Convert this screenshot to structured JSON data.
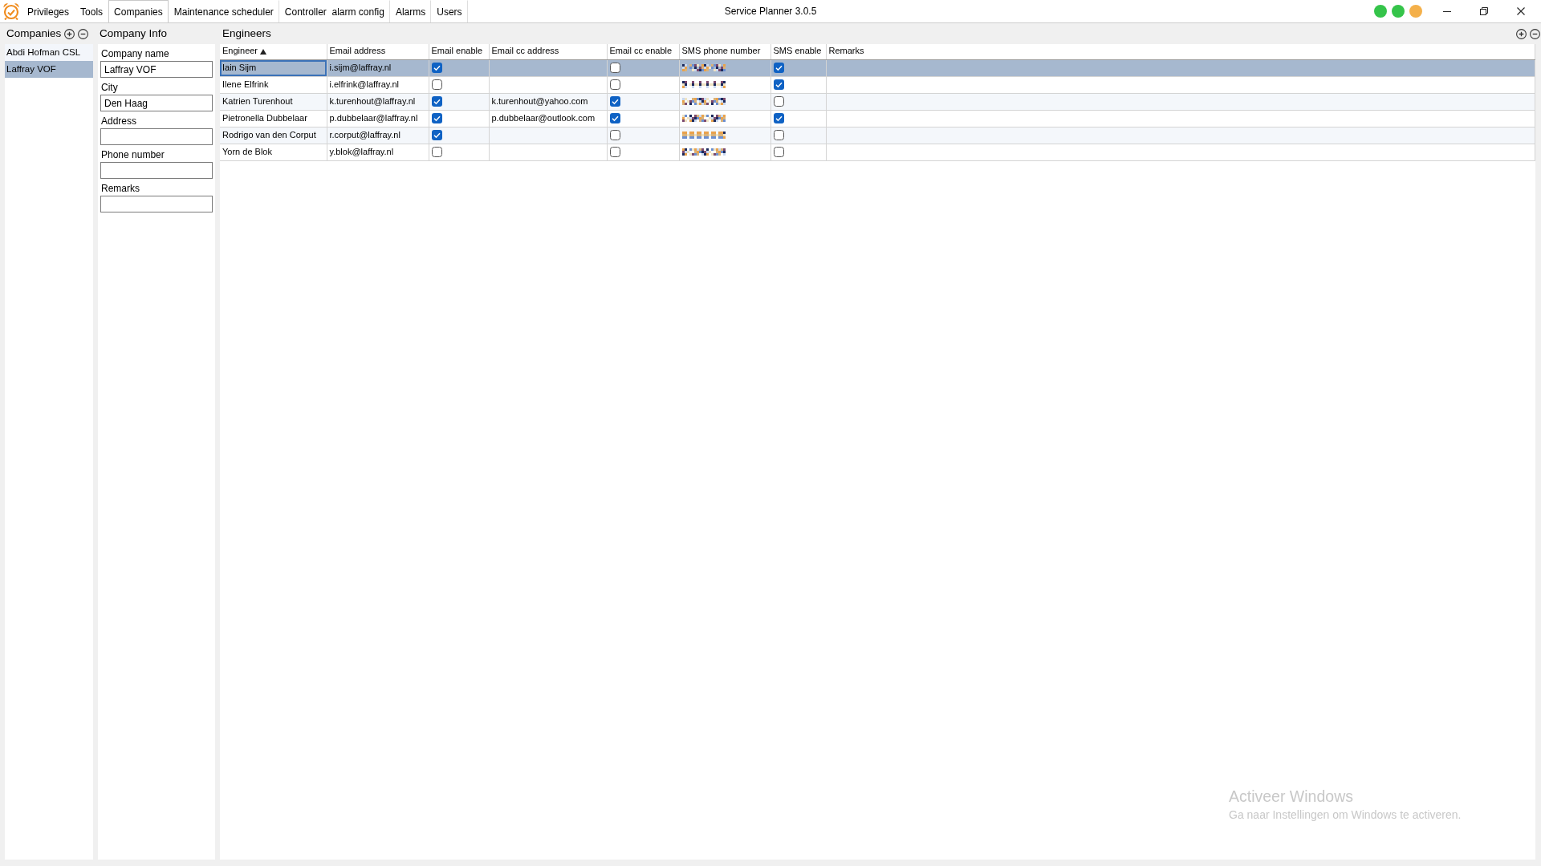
{
  "window": {
    "title": "Service Planner 3.0.5",
    "status_lights": [
      {
        "color": "#35c44a"
      },
      {
        "color": "#35c44a"
      },
      {
        "color": "#f4b04a"
      }
    ]
  },
  "menu_tabs": [
    {
      "label": "Privileges",
      "selected": false
    },
    {
      "label": "Tools",
      "selected": false
    },
    {
      "label": "Companies",
      "selected": true
    },
    {
      "label": "Maintenance scheduler",
      "selected": false
    },
    {
      "label": "Controller  alarm config",
      "selected": false
    },
    {
      "label": "Alarms",
      "selected": false
    },
    {
      "label": "Users",
      "selected": false
    }
  ],
  "companies": {
    "title": "Companies",
    "items": [
      {
        "label": "Abdi Hofman CSL",
        "selected": false
      },
      {
        "label": "Laffray VOF",
        "selected": true
      }
    ]
  },
  "company_info": {
    "title": "Company Info",
    "fields": [
      {
        "label": "Company name",
        "value": "Laffray VOF"
      },
      {
        "label": "City",
        "value": "Den Haag"
      },
      {
        "label": "Address"
      },
      {
        "label": "Phone number"
      },
      {
        "label": "Remarks"
      }
    ]
  },
  "engineers": {
    "title": "Engineers",
    "columns": [
      {
        "label": "Engineer",
        "kind": "text",
        "sorted": true
      },
      {
        "label": "Email address",
        "kind": "text",
        "sorted": false
      },
      {
        "label": "Email enable",
        "kind": "checkbox",
        "sorted": false
      },
      {
        "label": "Email cc address",
        "kind": "text",
        "sorted": false
      },
      {
        "label": "Email cc enable",
        "kind": "checkbox",
        "sorted": false
      },
      {
        "label": "SMS phone number",
        "kind": "pixelated",
        "sorted": false
      },
      {
        "label": "SMS enable",
        "kind": "checkbox",
        "sorted": false
      },
      {
        "label": "Remarks",
        "kind": "text",
        "sorted": false
      }
    ],
    "rows": [
      {
        "selected": true,
        "engineer": "Iain Sijm",
        "email_address": "i.sijm@laffray.nl",
        "email_enable": true,
        "email_cc_enable": false,
        "sms_enable": true
      },
      {
        "selected": false,
        "engineer": "Ilene Elfrink",
        "email_address": "i.elfrink@laffray.nl",
        "email_enable": false,
        "email_cc_enable": false,
        "sms_enable": true
      },
      {
        "selected": false,
        "engineer": "Katrien Turenhout",
        "email_address": "k.turenhout@laffray.nl",
        "email_enable": true,
        "email_cc_address": "k.turenhout@yahoo.com",
        "email_cc_enable": true,
        "sms_enable": false
      },
      {
        "selected": false,
        "engineer": "Pietronella Dubbelaar",
        "email_address": "p.dubbelaar@laffray.nl",
        "email_enable": true,
        "email_cc_address": "p.dubbelaar@outlook.com",
        "email_cc_enable": true,
        "sms_enable": true
      },
      {
        "selected": false,
        "engineer": "Rodrigo van den Corput",
        "email_address": "r.corput@laffray.nl",
        "email_enable": true,
        "email_cc_enable": false,
        "sms_enable": false
      },
      {
        "selected": false,
        "engineer": "Yorn de Blok",
        "email_address": "y.blok@laffray.nl",
        "email_enable": false,
        "email_cc_enable": false,
        "sms_enable": false
      }
    ]
  },
  "activation_notice": {
    "title": "Activeer Windows",
    "message": "Ga naar Instellingen om Windows te activeren."
  }
}
